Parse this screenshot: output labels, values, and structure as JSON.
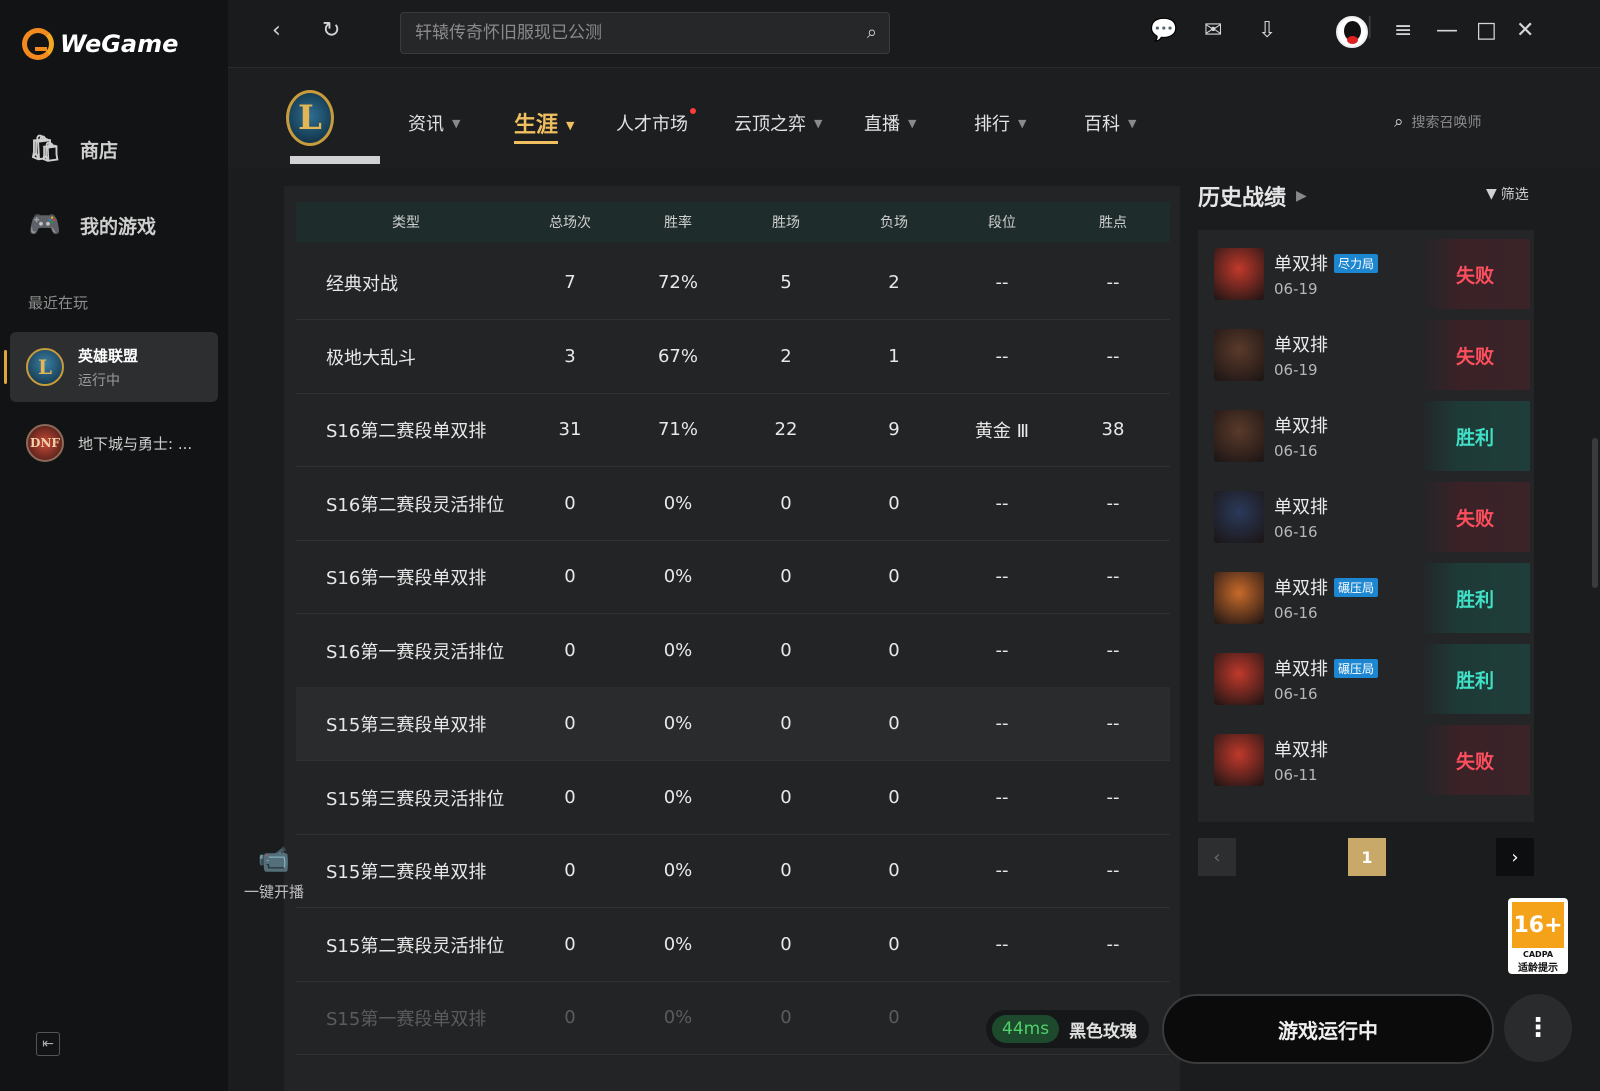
{
  "app": {
    "name": "WeGame"
  },
  "sidebar": {
    "items": [
      {
        "label": "商店",
        "icon": "shop-icon"
      },
      {
        "label": "我的游戏",
        "icon": "gamepad-icon"
      }
    ],
    "recent_label": "最近在玩",
    "games": [
      {
        "name": "英雄联盟",
        "status": "运行中",
        "icon": "lol-icon"
      },
      {
        "name": "地下城与勇士: ...",
        "icon": "dnf-icon"
      }
    ]
  },
  "topbar": {
    "search_placeholder": "轩辕传奇怀旧服现已公测"
  },
  "lol_nav": {
    "tabs": [
      {
        "label": "资讯"
      },
      {
        "label": "生涯"
      },
      {
        "label": "人才市场"
      },
      {
        "label": "云顶之弈"
      },
      {
        "label": "直播"
      },
      {
        "label": "排行"
      },
      {
        "label": "百科"
      }
    ],
    "summoner_search_placeholder": "搜索召唤师"
  },
  "table": {
    "headers": [
      "类型",
      "总场次",
      "胜率",
      "胜场",
      "负场",
      "段位",
      "胜点"
    ],
    "rows": [
      [
        "经典对战",
        "7",
        "72%",
        "5",
        "2",
        "--",
        "--"
      ],
      [
        "极地大乱斗",
        "3",
        "67%",
        "2",
        "1",
        "--",
        "--"
      ],
      [
        "S16第二赛段单双排",
        "31",
        "71%",
        "22",
        "9",
        "黄金 Ⅲ",
        "38"
      ],
      [
        "S16第二赛段灵活排位",
        "0",
        "0%",
        "0",
        "0",
        "--",
        "--"
      ],
      [
        "S16第一赛段单双排",
        "0",
        "0%",
        "0",
        "0",
        "--",
        "--"
      ],
      [
        "S16第一赛段灵活排位",
        "0",
        "0%",
        "0",
        "0",
        "--",
        "--"
      ],
      [
        "S15第三赛段单双排",
        "0",
        "0%",
        "0",
        "0",
        "--",
        "--"
      ],
      [
        "S15第三赛段灵活排位",
        "0",
        "0%",
        "0",
        "0",
        "--",
        "--"
      ],
      [
        "S15第二赛段单双排",
        "0",
        "0%",
        "0",
        "0",
        "--",
        "--"
      ],
      [
        "S15第二赛段灵活排位",
        "0",
        "0%",
        "0",
        "0",
        "--",
        "--"
      ],
      [
        "S15第一赛段单双排",
        "0",
        "0%",
        "0",
        "0",
        "--",
        "--"
      ]
    ]
  },
  "history": {
    "title": "历史战绩",
    "filter_label": "筛选",
    "matches": [
      {
        "mode": "单双排",
        "tag": "尽力局",
        "date": "06-19",
        "result": "失败",
        "outcome": "loss",
        "color": "#c0392b"
      },
      {
        "mode": "单双排",
        "tag": "",
        "date": "06-19",
        "result": "失败",
        "outcome": "loss",
        "color": "#5a3a2a"
      },
      {
        "mode": "单双排",
        "tag": "",
        "date": "06-16",
        "result": "胜利",
        "outcome": "win",
        "color": "#5a3a2a"
      },
      {
        "mode": "单双排",
        "tag": "",
        "date": "06-16",
        "result": "失败",
        "outcome": "loss",
        "color": "#2a3a5a"
      },
      {
        "mode": "单双排",
        "tag": "碾压局",
        "date": "06-16",
        "result": "胜利",
        "outcome": "win",
        "color": "#c86a2a"
      },
      {
        "mode": "单双排",
        "tag": "碾压局",
        "date": "06-16",
        "result": "胜利",
        "outcome": "win",
        "color": "#c0392b"
      },
      {
        "mode": "单双排",
        "tag": "",
        "date": "06-11",
        "result": "失败",
        "outcome": "loss",
        "color": "#c0392b"
      }
    ],
    "page": "1"
  },
  "live": {
    "label": "一键开播"
  },
  "age_rating": {
    "rating": "16+",
    "org": "CADPA",
    "tip": "适龄提示"
  },
  "bottom": {
    "ping": "44ms",
    "server": "黑色玫瑰",
    "play_label": "游戏运行中"
  }
}
